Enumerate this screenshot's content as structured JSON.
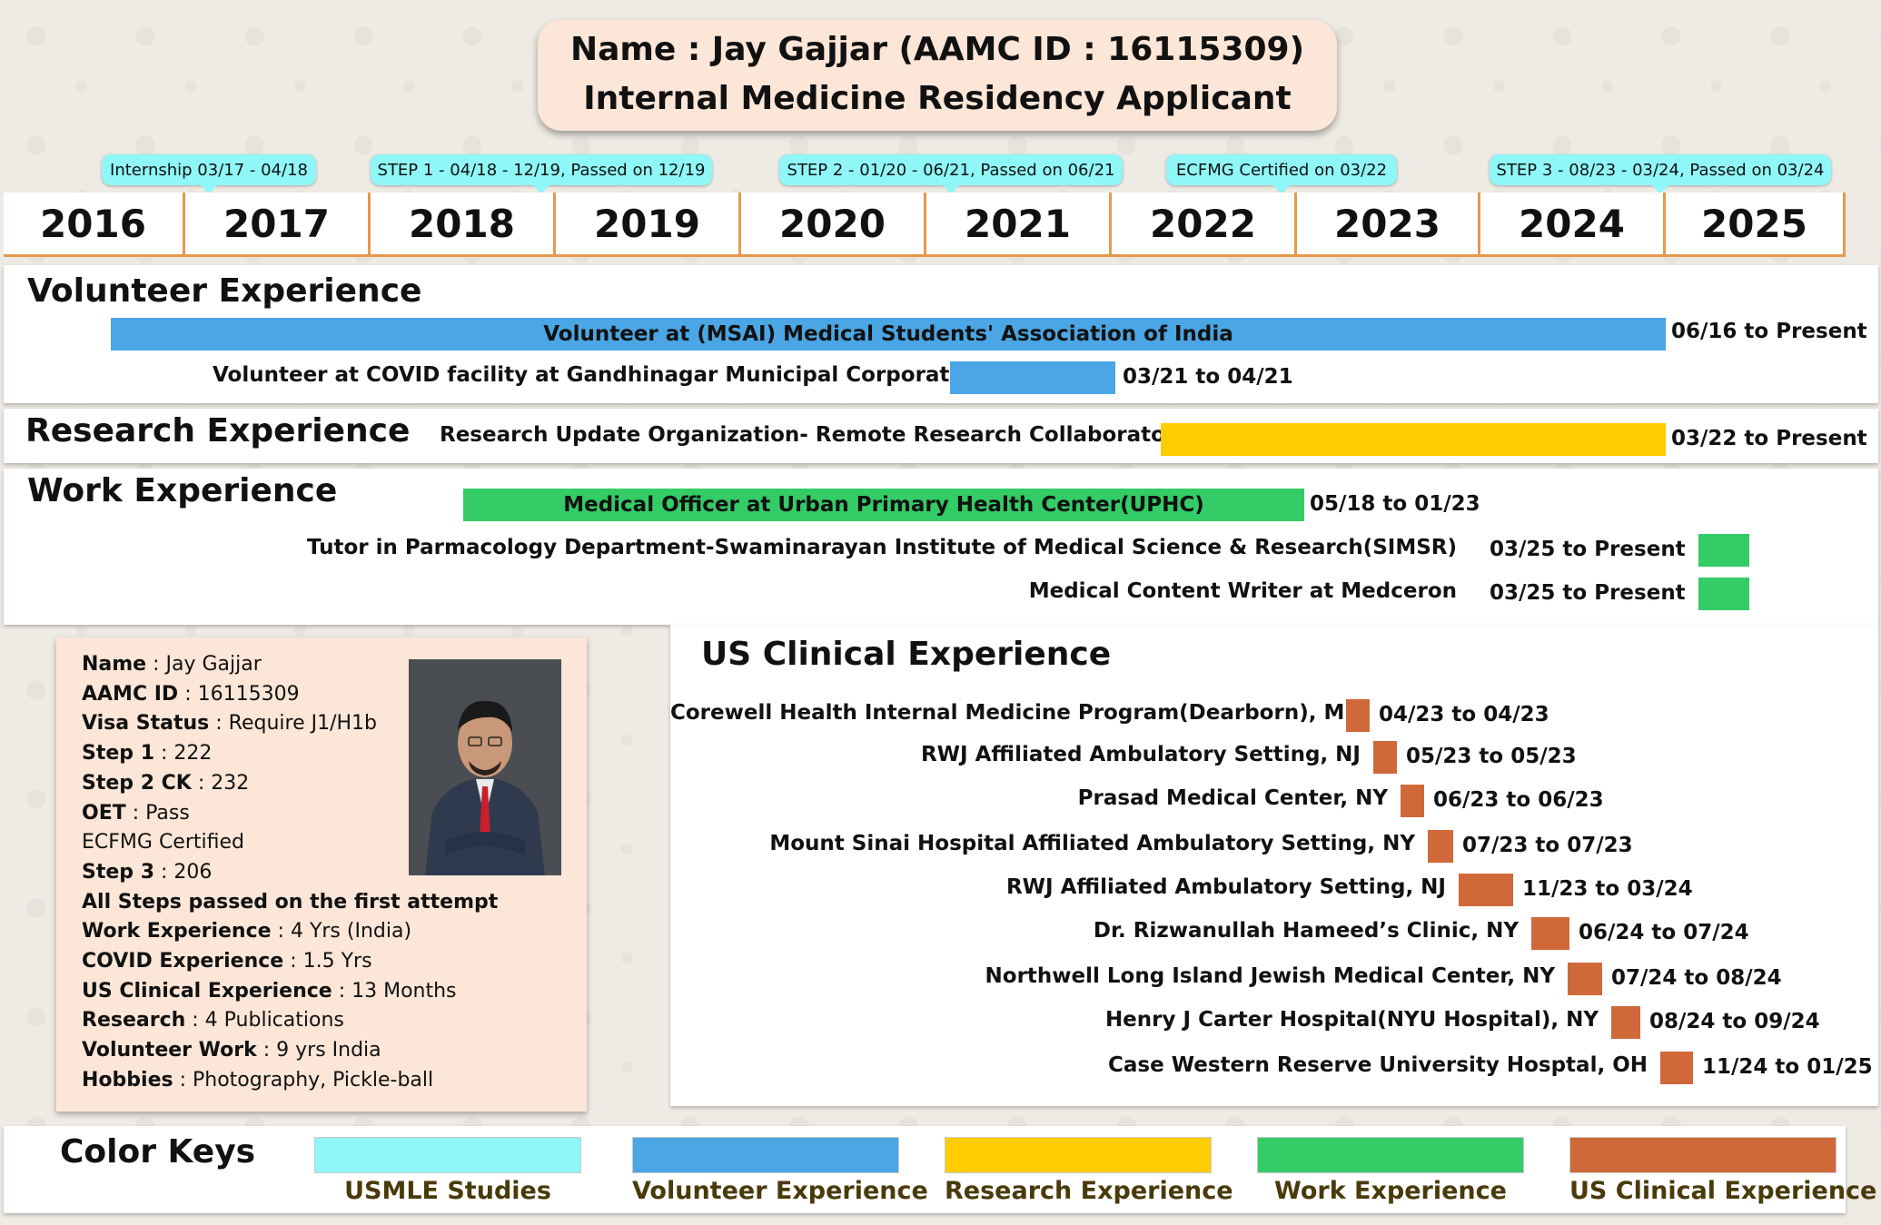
{
  "header": {
    "line1": "Name : Jay Gajjar (AAMC ID : 16115309)",
    "line2": "Internal Medicine Residency Applicant"
  },
  "timeline": {
    "years": [
      "2016",
      "2017",
      "2018",
      "2019",
      "2020",
      "2021",
      "2022",
      "2023",
      "2024",
      "2025"
    ],
    "milestones": [
      "Internship 03/17 - 04/18",
      "STEP 1 - 04/18 - 12/19, Passed on 12/19",
      "STEP 2 - 01/20 - 06/21, Passed on 06/21",
      "ECFMG Certified on 03/22",
      "STEP 3 - 08/23 - 03/24, Passed on 03/24"
    ]
  },
  "volunteer": {
    "title": "Volunteer Experience",
    "items": [
      {
        "label": "Volunteer at (MSAI) Medical Students' Association of India",
        "dates": "06/16 to Present"
      },
      {
        "label": "Volunteer at COVID facility at Gandhinagar Municipal Corporation",
        "dates": "03/21 to 04/21"
      }
    ]
  },
  "research": {
    "title": "Research Experience",
    "items": [
      {
        "label": "Research Update Organization- Remote Research Collaborator",
        "dates": "03/22 to Present"
      }
    ]
  },
  "work": {
    "title": "Work Experience",
    "items": [
      {
        "label": "Medical Officer at Urban Primary Health Center(UPHC)",
        "dates": "05/18 to 01/23"
      },
      {
        "label": "Tutor in Parmacology Department-Swaminarayan Institute of Medical Science & Research(SIMSR)",
        "dates": "03/25 to Present"
      },
      {
        "label": "Medical Content Writer at Medceron",
        "dates": "03/25 to Present"
      }
    ]
  },
  "profile": {
    "rows": [
      {
        "k": "Name",
        "v": " : Jay Gajjar"
      },
      {
        "k": "AAMC ID",
        "v": " : 16115309"
      },
      {
        "k": "Visa Status",
        "v": " : Require J1/H1b"
      },
      {
        "k": "Step 1",
        "v": " : 222"
      },
      {
        "k": "Step 2 CK",
        "v": " : 232"
      },
      {
        "k": "OET",
        "v": " : Pass"
      },
      {
        "k": "",
        "v": "ECFMG Certified"
      },
      {
        "k": "Step 3",
        "v": " : 206"
      },
      {
        "k": "All Steps passed on the first attempt",
        "v": ""
      },
      {
        "k": "Work Experience",
        "v": " : 4 Yrs (India)"
      },
      {
        "k": "COVID Experience",
        "v": " : 1.5 Yrs"
      },
      {
        "k": "US Clinical Experience",
        "v": " : 13 Months"
      },
      {
        "k": "Research",
        "v": " : 4 Publications"
      },
      {
        "k": "Volunteer Work",
        "v": " : 9 yrs India"
      },
      {
        "k": "Hobbies",
        "v": " : Photography, Pickle-ball"
      }
    ]
  },
  "usce": {
    "title": "US Clinical Experience",
    "items": [
      {
        "label": "Corewell Health Internal Medicine Program(Dearborn), MI",
        "dates": "04/23 to 04/23"
      },
      {
        "label": "RWJ Affiliated Ambulatory Setting, NJ",
        "dates": "05/23 to 05/23"
      },
      {
        "label": "Prasad Medical Center, NY",
        "dates": "06/23 to 06/23"
      },
      {
        "label": "Mount Sinai Hospital Affiliated Ambulatory Setting, NY",
        "dates": "07/23 to 07/23"
      },
      {
        "label": "RWJ Affiliated Ambulatory Setting, NJ",
        "dates": "11/23 to 03/24"
      },
      {
        "label": "Dr. Rizwanullah Hameed’s Clinic, NY",
        "dates": "06/24 to 07/24"
      },
      {
        "label": "Northwell Long Island Jewish Medical Center, NY",
        "dates": "07/24 to 08/24"
      },
      {
        "label": "Henry J Carter Hospital(NYU Hospital), NY",
        "dates": "08/24 to 09/24"
      },
      {
        "label": "Case Western Reserve University Hosptal, OH",
        "dates": "11/24 to 01/25"
      }
    ]
  },
  "keys": {
    "title": "Color Keys",
    "items": [
      {
        "label": "USMLE Studies",
        "color": "#8ff7f7"
      },
      {
        "label": "Volunteer Experience",
        "color": "#4aa6e4"
      },
      {
        "label": "Research Experience",
        "color": "#ffcc00"
      },
      {
        "label": "Work Experience",
        "color": "#33cc66"
      },
      {
        "label": "US Clinical Experience",
        "color": "#d0693a"
      }
    ]
  },
  "colors": {
    "usmle": "#8ff7f7",
    "volunteer": "#4aa6e4",
    "research": "#ffcc00",
    "work": "#33cc66",
    "usce": "#d0693a",
    "accent": "#e59a4b"
  }
}
